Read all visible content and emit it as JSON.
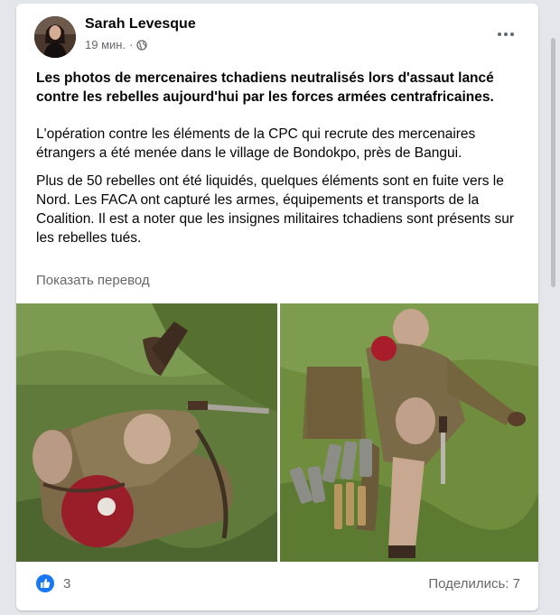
{
  "post": {
    "author": "Sarah Levesque",
    "time": "19 мин.",
    "separator": "·",
    "headline": "Les photos de mercenaires tchadiens neutralisés lors d'assaut lancé contre les rebelles aujourd'hui par les forces armées centrafricaines.",
    "paragraph1": "L'opération contre les éléments de la CPC qui recrute des mercenaires étrangers a été menée dans le village de Bondokpo, près de Bangui.",
    "paragraph2": "Plus de 50 rebelles ont été liquidés, quelques éléments sont en fuite vers le Nord. Les FACA ont capturé les armes, équipements et transports de la Coalition. Il est a noter que les insignes militaires tchadiens sont présents sur les rebelles tués.",
    "see_translation": "Показать перевод"
  },
  "footer": {
    "reaction_count": "3",
    "shares": "Поделились: 7"
  },
  "icons": {
    "privacy": "globe-icon",
    "menu": "more-options-icon",
    "reaction": "like-reaction-icon"
  },
  "colors": {
    "link_gray": "#65676b",
    "like_blue": "#1877f2",
    "background": "#e4e6eb"
  }
}
